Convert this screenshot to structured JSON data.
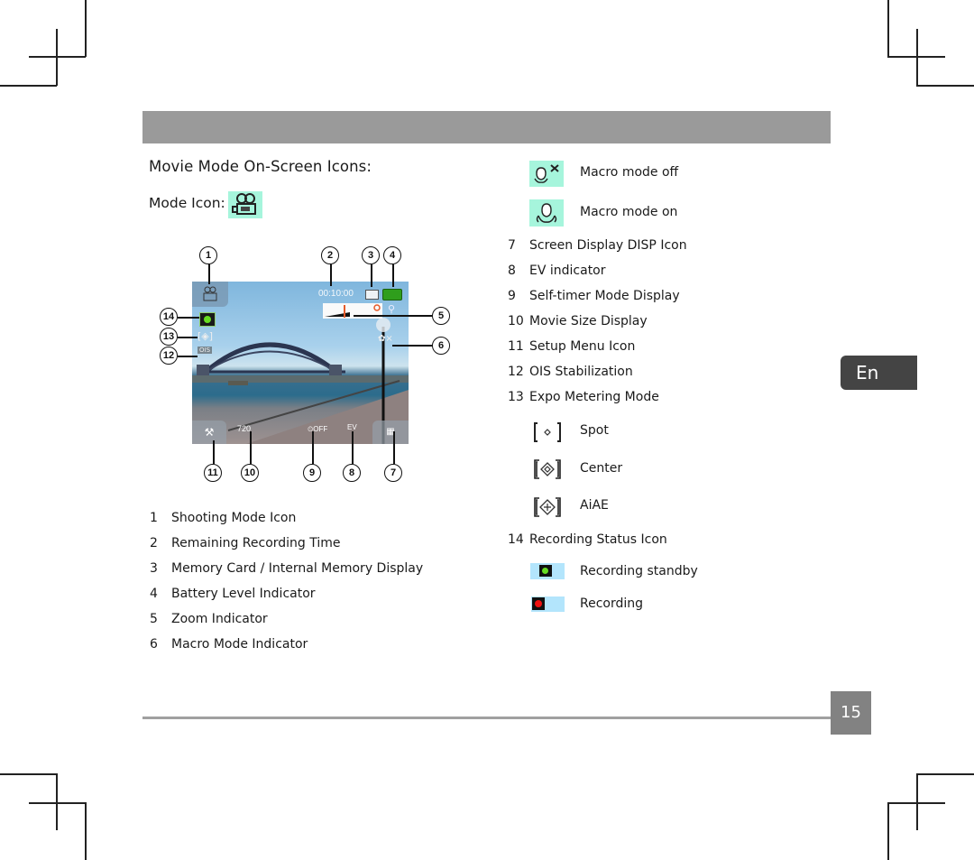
{
  "header": {
    "section_title": "Movie Mode On-Screen Icons:",
    "mode_icon_label": "Mode Icon:",
    "mode_icon": "movie-camera-icon"
  },
  "camera_screen": {
    "remaining_time": "00:10:00",
    "callouts_top": [
      "1",
      "2",
      "3",
      "4"
    ],
    "callouts_left": [
      "14",
      "13",
      "12"
    ],
    "callouts_right": [
      "5",
      "6"
    ],
    "callouts_bottom": [
      "11",
      "10",
      "9",
      "8",
      "7"
    ],
    "icons": {
      "shooting_mode": "movie-camera-icon",
      "memory": "memory-card-icon",
      "battery": "battery-full-icon",
      "zoom": "zoom-bar-icon",
      "macro": "macro-off-icon",
      "recording_status": "recording-standby-icon",
      "metering": "metering-center-icon",
      "ois": "ois-icon",
      "setup": "setup-menu-icon",
      "movie_size": "movie-size-icon",
      "self_timer": "self-timer-off-icon",
      "ev": "ev-icon",
      "disp": "disp-icon"
    }
  },
  "left_list": [
    {
      "num": "1",
      "label": "Shooting Mode Icon"
    },
    {
      "num": "2",
      "label": "Remaining Recording Time"
    },
    {
      "num": "3",
      "label": "Memory Card / Internal Memory Display"
    },
    {
      "num": "4",
      "label": "Battery Level Indicator"
    },
    {
      "num": "5",
      "label": "Zoom Indicator"
    },
    {
      "num": "6",
      "label": "Macro Mode Indicator"
    }
  ],
  "macro_options": [
    {
      "icon": "macro-off-icon",
      "label": "Macro mode off"
    },
    {
      "icon": "macro-on-icon",
      "label": "Macro mode on"
    }
  ],
  "right_list": [
    {
      "num": "7",
      "label": "Screen Display DISP Icon"
    },
    {
      "num": "8",
      "label": "EV indicator"
    },
    {
      "num": "9",
      "label": "Self-timer Mode Display"
    },
    {
      "num": "10",
      "label": "Movie Size Display"
    },
    {
      "num": "11",
      "label": "Setup Menu Icon"
    },
    {
      "num": "12",
      "label": "OIS Stabilization"
    },
    {
      "num": "13",
      "label": "Expo Metering Mode"
    }
  ],
  "metering_options": [
    {
      "icon": "metering-spot-icon",
      "label": "Spot"
    },
    {
      "icon": "metering-center-icon",
      "label": "Center"
    },
    {
      "icon": "metering-aiae-icon",
      "label": "AiAE"
    }
  ],
  "recording_status": {
    "num": "14",
    "label": "Recording Status Icon",
    "options": [
      {
        "icon": "recording-standby-icon",
        "label": "Recording standby",
        "dot_color": "#66dd22"
      },
      {
        "icon": "recording-icon",
        "label": "Recording",
        "dot_color": "#ee1111"
      }
    ]
  },
  "language_tab": "En",
  "page_number": "15",
  "colors": {
    "header_bar": "#9a9a9a",
    "mint_icon_bg": "#a6f5dc",
    "status_icon_bg": "#b3e5fc",
    "language_tab": "#444444",
    "page_number_bg": "#828282"
  }
}
